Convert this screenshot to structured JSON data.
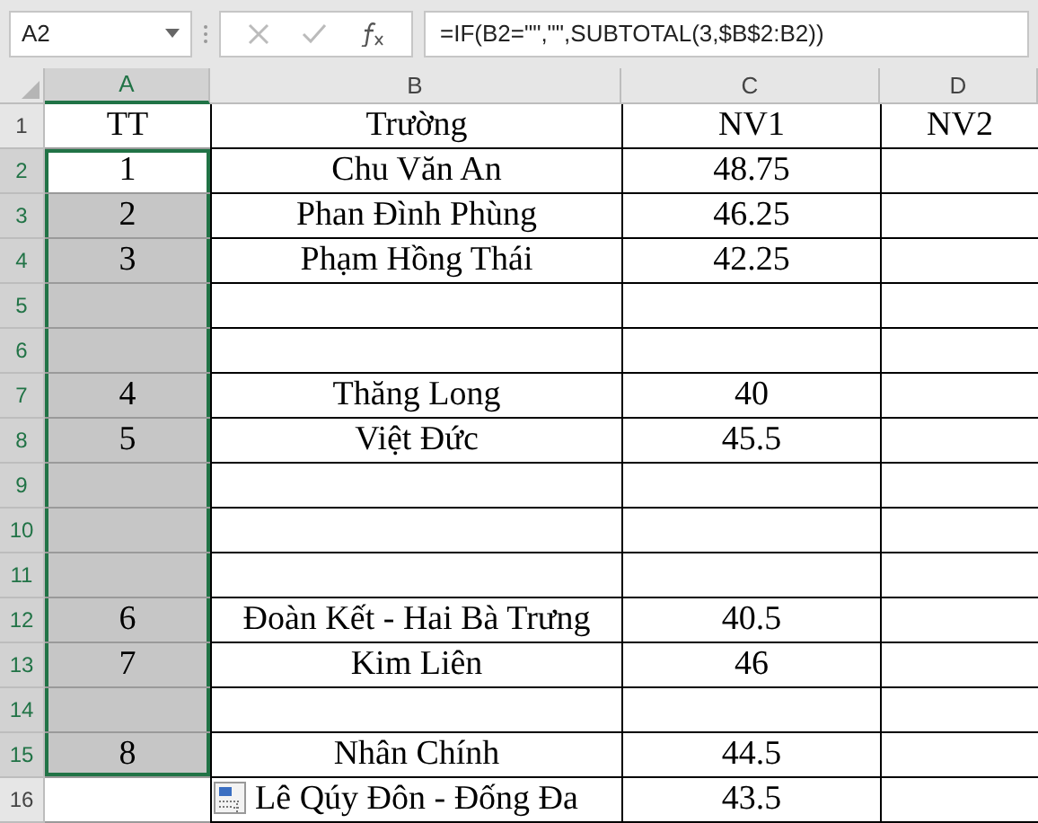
{
  "name_box": "A2",
  "formula": "=IF(B2=\"\",\"\",SUBTOTAL(3,$B$2:B2))",
  "columns": [
    {
      "label": "A",
      "selected": true
    },
    {
      "label": "B",
      "selected": false
    },
    {
      "label": "C",
      "selected": false
    },
    {
      "label": "D",
      "selected": false
    }
  ],
  "rows": [
    {
      "row": "1",
      "a": "TT",
      "b": "Trường",
      "c": "NV1",
      "d": "NV2",
      "selected": false
    },
    {
      "row": "2",
      "a": "1",
      "b": "Chu Văn An",
      "c": "48.75",
      "selected": true,
      "active": true
    },
    {
      "row": "3",
      "a": "2",
      "b": "Phan Đình Phùng",
      "c": "46.25",
      "selected": true,
      "active": false
    },
    {
      "row": "4",
      "a": "3",
      "b": "Phạm Hồng Thái",
      "c": "42.25",
      "selected": true,
      "active": false
    },
    {
      "row": "5",
      "selected": true,
      "active": false
    },
    {
      "row": "6",
      "selected": true,
      "active": false
    },
    {
      "row": "7",
      "a": "4",
      "b": "Thăng Long",
      "c": "40",
      "selected": true,
      "active": false
    },
    {
      "row": "8",
      "a": "5",
      "b": "Việt Đức",
      "c": "45.5",
      "selected": true,
      "active": false
    },
    {
      "row": "9",
      "selected": true,
      "active": false
    },
    {
      "row": "10",
      "selected": true,
      "active": false
    },
    {
      "row": "11",
      "selected": true,
      "active": false
    },
    {
      "row": "12",
      "a": "6",
      "b": "Đoàn Kết - Hai Bà Trưng",
      "c": "40.5",
      "selected": true,
      "active": false
    },
    {
      "row": "13",
      "a": "7",
      "b": "Kim Liên",
      "c": "46",
      "selected": true,
      "active": false
    },
    {
      "row": "14",
      "selected": true,
      "active": false
    },
    {
      "row": "15",
      "a": "8",
      "b": "Nhân Chính",
      "c": "44.5",
      "selected": true,
      "active": false
    },
    {
      "row": "16",
      "b": "Lê Qúy Đôn - Đống Đa",
      "c": "43.5",
      "selected": false,
      "paste_options": true
    }
  ]
}
